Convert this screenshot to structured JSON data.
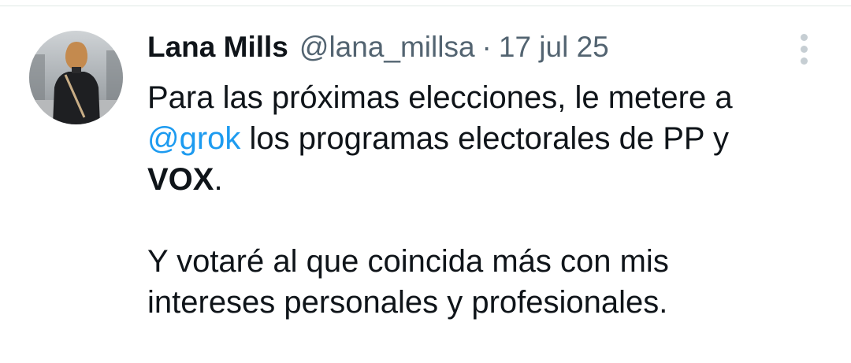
{
  "tweet": {
    "author": {
      "display_name": "Lana Mills",
      "handle": "@lana_millsa",
      "avatar": "avatar-photo-woman-back-view"
    },
    "separator": "·",
    "timestamp": "17 jul 25",
    "more_icon": "more-vertical-icon",
    "body": {
      "line1": "Para las próximas elecciones, le metere a",
      "mention": "@grok",
      "line2_rest": " los programas electorales de PP y",
      "bold_party": "VOX",
      "line3_rest": ".",
      "paragraph2_line1": "Y votaré al que coincida más con mis",
      "paragraph2_line2": "intereses personales y profesionales."
    }
  },
  "colors": {
    "text": "#0f1419",
    "secondary": "#536471",
    "link": "#1d9bf0",
    "divider": "#dfe8e6"
  }
}
